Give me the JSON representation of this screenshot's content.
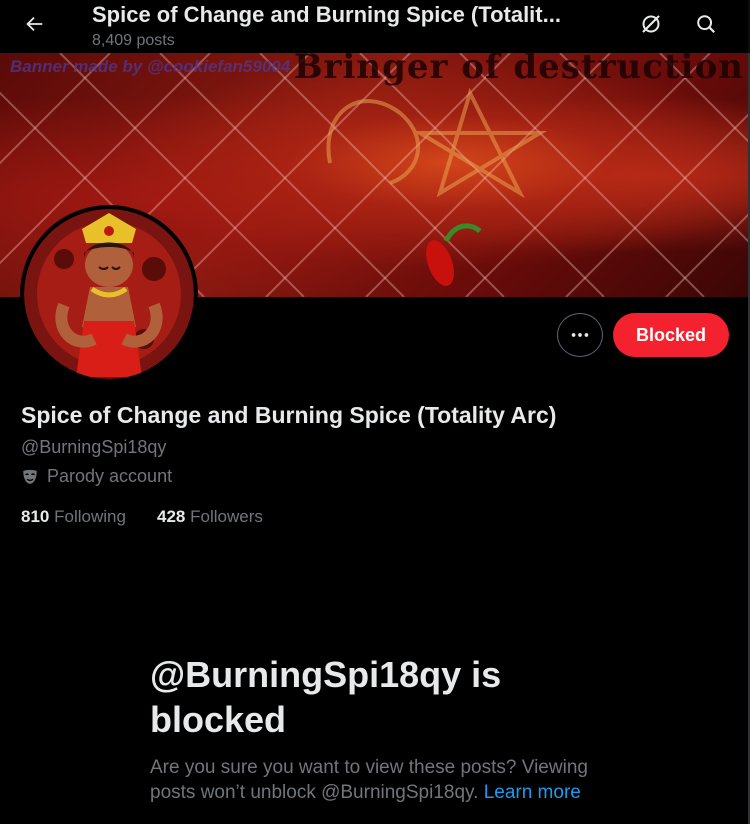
{
  "header": {
    "title": "Spice of Change and Burning Spice (Totalit...",
    "post_count": "8,409 posts",
    "icons": [
      "back-arrow-icon",
      "grok-icon",
      "search-icon"
    ]
  },
  "banner": {
    "credit": "Banner made by @cookiefan59004",
    "title_text": "Bringer of destruction"
  },
  "actions": {
    "more_label": "···",
    "blocked_label": "Blocked",
    "blocked_color": "#f4212e"
  },
  "profile": {
    "display_name": "Spice of Change and Burning Spice (Totality Arc)",
    "handle": "@BurningSpi18qy",
    "label_icon": "parody-mask-icon",
    "label": "Parody account",
    "following_count": "810",
    "following_label": "Following",
    "followers_count": "428",
    "followers_label": "Followers"
  },
  "blocked_notice": {
    "title": "@BurningSpi18qy is blocked",
    "description": "Are you sure you want to view these posts? Viewing posts won’t unblock @BurningSpi18qy.",
    "learn_more": "Learn more",
    "link_color": "#1d9bf0"
  }
}
